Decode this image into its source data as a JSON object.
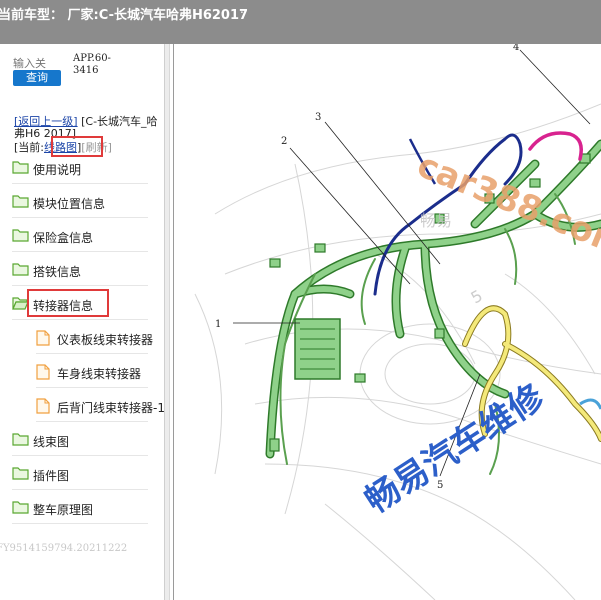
{
  "window": {
    "title": "当前车型：  厂家:C-长城汽车哈弗H62017",
    "title_suffix": "."
  },
  "search": {
    "placeholder": "输入关",
    "button": "查询"
  },
  "app_code": "APP.60-3416",
  "nav": {
    "back": "[返回上一级]",
    "vehicle": "[C-长城汽车_哈弗H6 2017]",
    "current_prefix": "[当前:",
    "current": "线路图",
    "current_suffix": "]",
    "refresh": "[刷新]"
  },
  "tree": [
    {
      "label": "使用说明",
      "type": "folder"
    },
    {
      "label": "模块位置信息",
      "type": "folder"
    },
    {
      "label": "保险盒信息",
      "type": "folder"
    },
    {
      "label": "搭铁信息",
      "type": "folder"
    },
    {
      "label": "转接器信息",
      "type": "folder",
      "open": true
    },
    {
      "label": "仪表板线束转接器",
      "type": "file"
    },
    {
      "label": "车身线束转接器",
      "type": "file"
    },
    {
      "label": "后背门线束转接器-1",
      "type": "file"
    },
    {
      "label": "线束图",
      "type": "folder"
    },
    {
      "label": "插件图",
      "type": "folder"
    },
    {
      "label": "整车原理图",
      "type": "folder"
    }
  ],
  "footer_id": "FY9514159794.20211222",
  "diagram": {
    "callouts": [
      "1",
      "2",
      "3",
      "4",
      "5"
    ],
    "watermarks": [
      "car388.com",
      "畅易汽车维修",
      "畅易",
      "5"
    ],
    "colors": {
      "harness_green": "#8fd18a",
      "harness_blue": "#1b2d8c",
      "harness_magenta": "#d8238f",
      "harness_yellow": "#f4e97a",
      "watermark_blue": "#2c5fc9",
      "watermark_orange": "#e8a06a"
    }
  }
}
